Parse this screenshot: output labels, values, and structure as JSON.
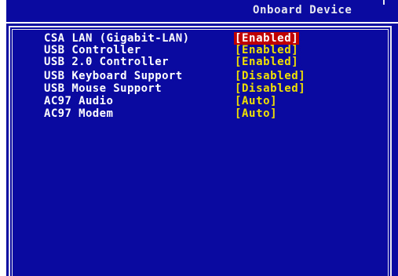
{
  "header": {
    "title": "Onboard Device"
  },
  "settings": [
    {
      "label": "CSA LAN (Gigabit-LAN)",
      "value": "[Enabled]",
      "selected": true
    },
    {
      "label": "USB Controller",
      "value": "[Enabled]",
      "selected": false
    },
    {
      "label": "USB 2.0 Controller",
      "value": "[Enabled]",
      "selected": false
    },
    {
      "label": "USB Keyboard Support",
      "value": "[Disabled]",
      "selected": false
    },
    {
      "label": "USB Mouse Support",
      "value": "[Disabled]",
      "selected": false
    },
    {
      "label": "AC97 Audio",
      "value": "[Auto]",
      "selected": false
    },
    {
      "label": "AC97 Modem",
      "value": "[Auto]",
      "selected": false
    }
  ],
  "colors": {
    "background": "#0a0aa0",
    "label": "#ffffff",
    "value": "#f0e000",
    "selection": "#c00000"
  }
}
